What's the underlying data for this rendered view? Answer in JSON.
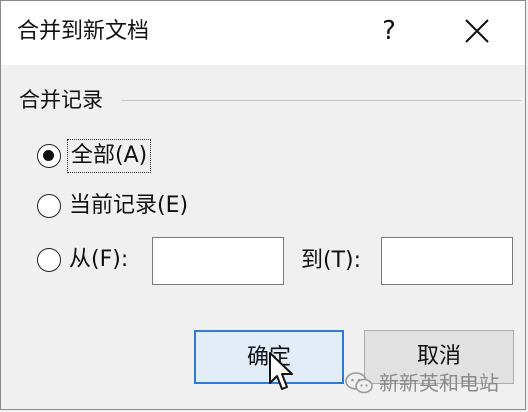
{
  "dialog": {
    "title": "合并到新文档",
    "help_label": "?",
    "close_icon": "close-icon"
  },
  "group": {
    "label": "合并记录"
  },
  "options": {
    "all": {
      "label": "全部(A)",
      "checked": true
    },
    "current": {
      "label": "当前记录(E)",
      "checked": false
    },
    "from": {
      "label": "从(F):",
      "checked": false
    }
  },
  "range": {
    "from_value": "",
    "to_label": "到(T):",
    "to_value": ""
  },
  "buttons": {
    "ok_label": "确定",
    "cancel_label": "取消"
  },
  "watermark": {
    "text": "新新英和电站",
    "icon": "wechat-icon"
  },
  "colors": {
    "ok_border": "#2f7ad6",
    "ok_background": "#e3edf8",
    "cancel_background": "#e1e1e1",
    "title_background": "#ffffff",
    "dialog_background": "#f0f0f0"
  }
}
